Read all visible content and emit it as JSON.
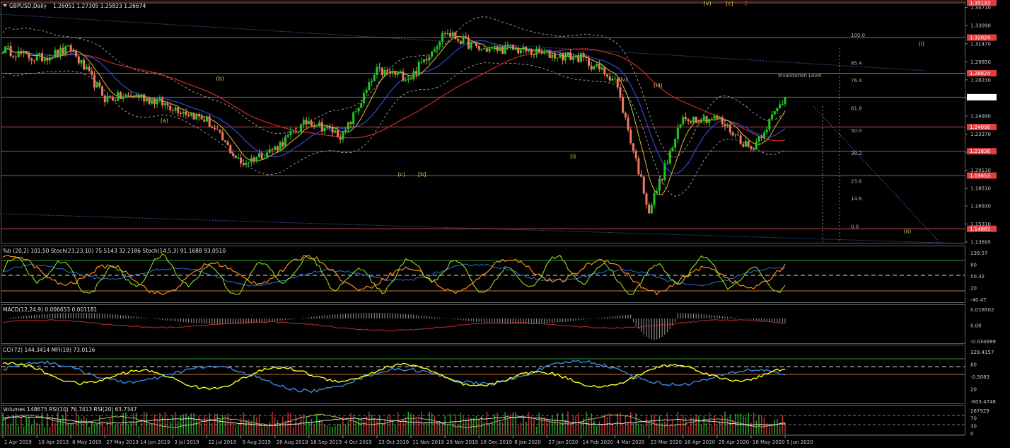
{
  "header": {
    "symbol": "GBPUSD,Daily",
    "ohlc": "1.26051 1.27305 1.25823 1.26674"
  },
  "price_axis": {
    "ticks": [
      "1.34710",
      "1.33090",
      "1.31470",
      "1.29850",
      "1.28230",
      "1.26610",
      "1.24990",
      "1.23370",
      "1.21750",
      "1.20130",
      "1.18510",
      "1.16930",
      "1.15310",
      "1.13695"
    ],
    "labels": [
      {
        "text": "1.35133",
        "color": "#e04040"
      },
      {
        "text": "1.32024",
        "color": "#e04040"
      },
      {
        "text": "1.28824",
        "color": "#e04040"
      },
      {
        "text": "1.26674",
        "color": "#202020",
        "bg": "#ffffff"
      },
      {
        "text": "1.24006",
        "color": "#e04040"
      },
      {
        "text": "1.21836",
        "color": "#e04040"
      },
      {
        "text": "1.19653",
        "color": "#e04040"
      },
      {
        "text": "1.14883",
        "color": "#e04040"
      }
    ]
  },
  "fib_levels": [
    "100.0",
    "85.4",
    "76.4",
    "61.8",
    "50.0",
    "38.2",
    "23.6",
    "14.6",
    "0.0"
  ],
  "invalidation_label": "Invalidation Level",
  "wave_labels": [
    "(a)",
    "(b)",
    "(c)",
    "[b]",
    "(i)",
    "(ii)",
    "(iii)",
    "(iv)",
    "(v)",
    "[c]",
    "2",
    "(i)",
    "(ii)",
    "(iii)",
    "(iv)"
  ],
  "x_dates": [
    "1 Apr 2019",
    "19 Apr 2019",
    "8 May 2019",
    "27 May 2019",
    "14 Jun 2019",
    "3 Jul 2019",
    "22 Jul 2019",
    "9 Aug 2019",
    "28 Aug 2019",
    "16 Sep 2019",
    "4 Oct 2019",
    "23 Oct 2019",
    "11 Nov 2019",
    "29 Nov 2019",
    "18 Dec 2019",
    "8 Jan 2020",
    "27 Jan 2020",
    "14 Feb 2020",
    "4 Mar 2020",
    "23 Mar 2020",
    "10 Apr 2020",
    "29 Apr 2020",
    "18 May 2020",
    "5 Jun 2020"
  ],
  "panels": {
    "stoch": {
      "header": "%b (20,2) 101.50   Stoch(23,23,10) 75.5143 32.2186   Stoch(14,5,3) 91.1688 93.0510",
      "ticks": [
        "139.57",
        "80",
        "50.32",
        "20",
        "-40.47"
      ]
    },
    "macd": {
      "header": "MACD(12,24,9) 0.006653 0.001181",
      "ticks": [
        "0.016502",
        "0.00",
        "-0.034699"
      ]
    },
    "cci": {
      "header": "CCI(72) 144.3414   MFI(18) 73.0116",
      "ticks": [
        "329.4157",
        "80",
        "-0.5083",
        "20",
        "-603.4746"
      ]
    },
    "vol": {
      "header": "Volumes 148675   RSI(10) 76.7413   RSI(20) 63.7347",
      "ticks": [
        "267929",
        "70",
        "30",
        "0"
      ]
    }
  },
  "chart_data": {
    "type": "candlestick",
    "symbol": "GBPUSD",
    "timeframe": "Daily",
    "ylim": [
      1.13695,
      1.35133
    ],
    "last": {
      "open": 1.26051,
      "high": 1.27305,
      "low": 1.25823,
      "close": 1.26674
    },
    "close_path": [
      [
        "1 Apr 2019",
        1.31
      ],
      [
        "19 Apr 2019",
        1.301
      ],
      [
        "8 May 2019",
        1.31
      ],
      [
        "27 May 2019",
        1.266
      ],
      [
        "14 Jun 2019",
        1.268
      ],
      [
        "3 Jul 2019",
        1.258
      ],
      [
        "22 Jul 2019",
        1.246
      ],
      [
        "9 Aug 2019",
        1.207
      ],
      [
        "28 Aug 2019",
        1.221
      ],
      [
        "16 Sep 2019",
        1.246
      ],
      [
        "4 Oct 2019",
        1.232
      ],
      [
        "23 Oct 2019",
        1.29
      ],
      [
        "11 Nov 2019",
        1.285
      ],
      [
        "29 Nov 2019",
        1.325
      ],
      [
        "18 Dec 2019",
        1.31
      ],
      [
        "8 Jan 2020",
        1.31
      ],
      [
        "27 Jan 2020",
        1.305
      ],
      [
        "14 Feb 2020",
        1.302
      ],
      [
        "4 Mar 2020",
        1.283
      ],
      [
        "23 Mar 2020",
        1.165
      ],
      [
        "10 Apr 2020",
        1.248
      ],
      [
        "29 Apr 2020",
        1.248
      ],
      [
        "18 May 2020",
        1.22
      ],
      [
        "5 Jun 2020",
        1.2667
      ]
    ],
    "horizontal_levels": [
      1.35133,
      1.32024,
      1.28824,
      1.24006,
      1.21836,
      1.19653,
      1.14883
    ]
  }
}
